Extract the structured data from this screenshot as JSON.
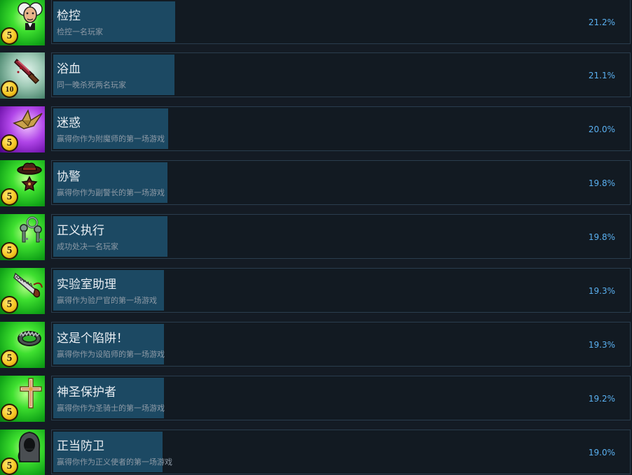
{
  "achievements": [
    {
      "title": "检控",
      "description": "检控一名玩家",
      "percent_label": "21.2%",
      "percent": 21.2,
      "badge": "5",
      "icon": "gentleman-portrait-icon",
      "bg": "green"
    },
    {
      "title": "浴血",
      "description": "同一晚杀死两名玩家",
      "percent_label": "21.1%",
      "percent": 21.1,
      "badge": "10",
      "icon": "bloody-knife-icon",
      "bg": "teal"
    },
    {
      "title": "迷惑",
      "description": "赢得你作为附魔师的第一场游戏",
      "percent_label": "20.0%",
      "percent": 20.0,
      "badge": "5",
      "icon": "paper-crane-icon",
      "bg": "purple"
    },
    {
      "title": "协警",
      "description": "赢得你作为副警长的第一场游戏",
      "percent_label": "19.8%",
      "percent": 19.8,
      "badge": "5",
      "icon": "sheriff-hat-icon",
      "bg": "green"
    },
    {
      "title": "正义执行",
      "description": "成功处决一名玩家",
      "percent_label": "19.8%",
      "percent": 19.8,
      "badge": "5",
      "icon": "keys-icon",
      "bg": "green"
    },
    {
      "title": "实验室助理",
      "description": "赢得作为验尸官的第一场游戏",
      "percent_label": "19.3%",
      "percent": 19.3,
      "badge": "5",
      "icon": "bone-saw-icon",
      "bg": "green"
    },
    {
      "title": "这是个陷阱！",
      "description": "赢得你作为设陷师的第一场游戏",
      "percent_label": "19.3%",
      "percent": 19.3,
      "badge": "5",
      "icon": "bear-trap-icon",
      "bg": "green"
    },
    {
      "title": "神圣保护者",
      "description": "赢得你作为圣骑士的第一场游戏",
      "percent_label": "19.2%",
      "percent": 19.2,
      "badge": "5",
      "icon": "holy-cross-icon",
      "bg": "green"
    },
    {
      "title": "正当防卫",
      "description": "赢得你作为正义使者的第一场游戏",
      "percent_label": "19.0%",
      "percent": 19.0,
      "badge": "5",
      "icon": "hooded-vigilante-icon",
      "bg": "green"
    }
  ]
}
